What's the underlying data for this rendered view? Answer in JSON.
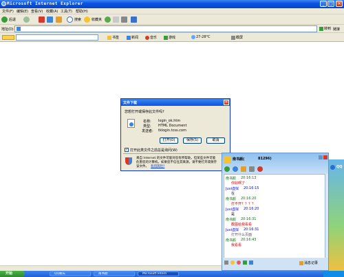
{
  "window": {
    "title": "Microsoft Internet Explorer"
  },
  "menu": [
    "文件(F)",
    "编辑(E)",
    "查看(V)",
    "收藏(A)",
    "工具(T)",
    "帮助(H)"
  ],
  "toolbar": {
    "back": "后退",
    "search": "搜索",
    "favorites": "收藏夹"
  },
  "address": {
    "label": "地址(D)",
    "go": "转到",
    "links": "链接"
  },
  "links": [
    "书签",
    "新闻",
    "音乐",
    "游戏",
    "27-28°C",
    "截屏"
  ],
  "dialog": {
    "title": "文件下载",
    "question": "您想打开或保存此文件吗?",
    "name_label": "名称:",
    "name_value": "login_ok.htm",
    "type_label": "类型:",
    "type_value": "HTML Document",
    "from_label": "发送者:",
    "from_value": "tklogin.tcss.com",
    "open": "打开(O)",
    "save": "保存(S)",
    "cancel": "取消",
    "checkbox": "打开此类文件之前总是询问(W)",
    "warning1": "来自 Internet 的文件可能对您有所帮助，但某些文件可能",
    "warning2": "危害您的计算机。如果您不信任其来源，请不要打开或保存",
    "warning3": "该文件。",
    "risk_link": "有何风险?"
  },
  "qq": {
    "name": "南书颜(",
    "number": "81296)",
    "signature": "QQ",
    "side_label": "QQ",
    "messages": [
      {
        "sender": "南书颜",
        "time": "20:16:13",
        "text": "你好啊了"
      },
      {
        "sender": "Juvi虚拟",
        "time": "20:16:15",
        "text": "在"
      },
      {
        "sender": "南书颜",
        "time": "20:16:20",
        "text": "打不开？？？？"
      },
      {
        "sender": "Juvi虚拟",
        "time": "20:16:20",
        "text": "是"
      },
      {
        "sender": "南书颜",
        "time": "20:16:31",
        "text": "截图给我看看"
      },
      {
        "sender": "Juvi虚拟",
        "time": "20:16:31",
        "text": "打开什么页面"
      },
      {
        "sender": "南书颜",
        "time": "20:16:43",
        "text": "我看看"
      }
    ],
    "history": "消息记录"
  },
  "taskbar": {
    "start": "开始",
    "tasks": [
      "QQ聊天",
      "南书颜",
      "Microsoft Intern"
    ],
    "time": ""
  },
  "colors": {
    "accent": "#0a54e3",
    "chat_red": "#cc0000",
    "chat_green": "#007700"
  }
}
